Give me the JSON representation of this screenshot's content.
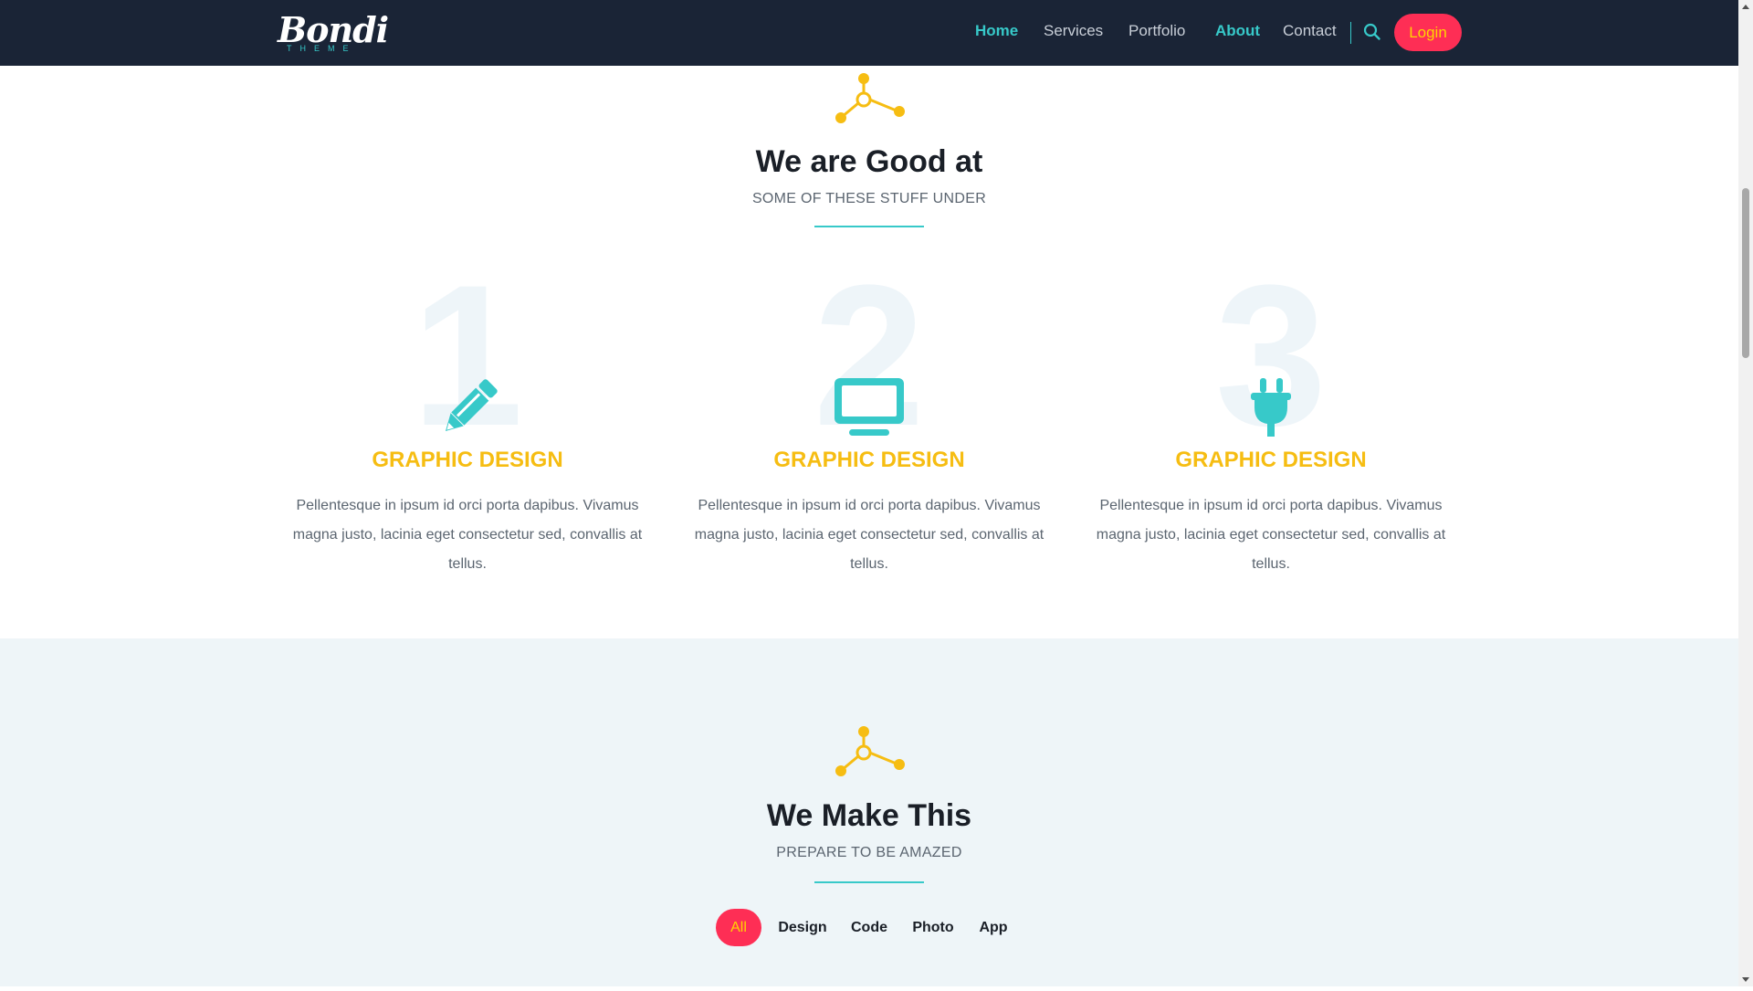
{
  "brand": {
    "name": "Bondi",
    "tagline": "THEME"
  },
  "nav": {
    "items": [
      {
        "label": "Home",
        "active": true
      },
      {
        "label": "Services",
        "active": false
      },
      {
        "label": "Portfolio",
        "active": false
      },
      {
        "label": "About",
        "active": true
      },
      {
        "label": "Contact",
        "active": false
      }
    ],
    "login_label": "Login"
  },
  "section_good": {
    "icon": "molecule-icon",
    "title": "We are Good at",
    "subtitle": "SOME OF THESE STUFF UNDER",
    "features": [
      {
        "number": "1",
        "icon": "pencil-icon",
        "title": "GRAPHIC DESIGN",
        "text": "Pellentesque in ipsum id orci porta dapibus. Vivamus magna justo, lacinia eget consectetur sed, convallis at tellus."
      },
      {
        "number": "2",
        "icon": "monitor-icon",
        "title": "GRAPHIC DESIGN",
        "text": "Pellentesque in ipsum id orci porta dapibus. Vivamus magna justo, lacinia eget consectetur sed, convallis at tellus."
      },
      {
        "number": "3",
        "icon": "plug-icon",
        "title": "GRAPHIC DESIGN",
        "text": "Pellentesque in ipsum id orci porta dapibus. Vivamus magna justo, lacinia eget consectetur sed, convallis at tellus."
      }
    ]
  },
  "section_make": {
    "icon": "molecule-icon",
    "title": "We Make This",
    "subtitle": "PREPARE TO BE AMAZED",
    "filters": [
      {
        "label": "All",
        "active": true
      },
      {
        "label": "Design",
        "active": false
      },
      {
        "label": "Code",
        "active": false
      },
      {
        "label": "Photo",
        "active": false
      },
      {
        "label": "App",
        "active": false
      }
    ]
  },
  "colors": {
    "nav_bg": "#1a2436",
    "accent_teal": "#37c9c9",
    "accent_yellow": "#f6bd12",
    "accent_red": "#fe2e55",
    "section_alt_bg": "#eef5f8"
  }
}
